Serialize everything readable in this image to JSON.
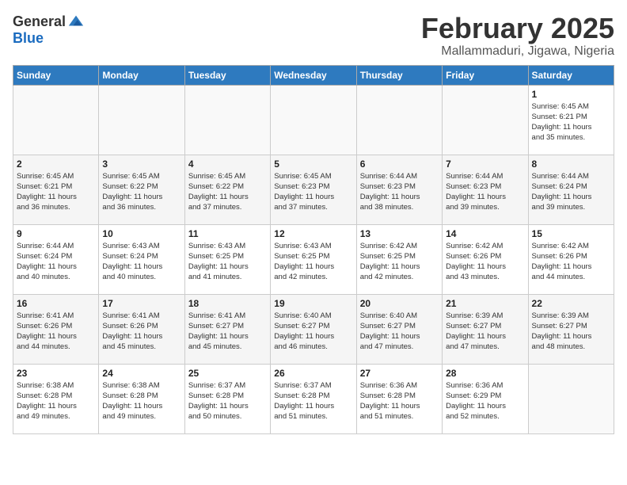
{
  "header": {
    "logo_general": "General",
    "logo_blue": "Blue",
    "month": "February 2025",
    "location": "Mallammaduri, Jigawa, Nigeria"
  },
  "days_of_week": [
    "Sunday",
    "Monday",
    "Tuesday",
    "Wednesday",
    "Thursday",
    "Friday",
    "Saturday"
  ],
  "weeks": [
    [
      {
        "day": "",
        "info": ""
      },
      {
        "day": "",
        "info": ""
      },
      {
        "day": "",
        "info": ""
      },
      {
        "day": "",
        "info": ""
      },
      {
        "day": "",
        "info": ""
      },
      {
        "day": "",
        "info": ""
      },
      {
        "day": "1",
        "info": "Sunrise: 6:45 AM\nSunset: 6:21 PM\nDaylight: 11 hours\nand 35 minutes."
      }
    ],
    [
      {
        "day": "2",
        "info": "Sunrise: 6:45 AM\nSunset: 6:21 PM\nDaylight: 11 hours\nand 36 minutes."
      },
      {
        "day": "3",
        "info": "Sunrise: 6:45 AM\nSunset: 6:22 PM\nDaylight: 11 hours\nand 36 minutes."
      },
      {
        "day": "4",
        "info": "Sunrise: 6:45 AM\nSunset: 6:22 PM\nDaylight: 11 hours\nand 37 minutes."
      },
      {
        "day": "5",
        "info": "Sunrise: 6:45 AM\nSunset: 6:23 PM\nDaylight: 11 hours\nand 37 minutes."
      },
      {
        "day": "6",
        "info": "Sunrise: 6:44 AM\nSunset: 6:23 PM\nDaylight: 11 hours\nand 38 minutes."
      },
      {
        "day": "7",
        "info": "Sunrise: 6:44 AM\nSunset: 6:23 PM\nDaylight: 11 hours\nand 39 minutes."
      },
      {
        "day": "8",
        "info": "Sunrise: 6:44 AM\nSunset: 6:24 PM\nDaylight: 11 hours\nand 39 minutes."
      }
    ],
    [
      {
        "day": "9",
        "info": "Sunrise: 6:44 AM\nSunset: 6:24 PM\nDaylight: 11 hours\nand 40 minutes."
      },
      {
        "day": "10",
        "info": "Sunrise: 6:43 AM\nSunset: 6:24 PM\nDaylight: 11 hours\nand 40 minutes."
      },
      {
        "day": "11",
        "info": "Sunrise: 6:43 AM\nSunset: 6:25 PM\nDaylight: 11 hours\nand 41 minutes."
      },
      {
        "day": "12",
        "info": "Sunrise: 6:43 AM\nSunset: 6:25 PM\nDaylight: 11 hours\nand 42 minutes."
      },
      {
        "day": "13",
        "info": "Sunrise: 6:42 AM\nSunset: 6:25 PM\nDaylight: 11 hours\nand 42 minutes."
      },
      {
        "day": "14",
        "info": "Sunrise: 6:42 AM\nSunset: 6:26 PM\nDaylight: 11 hours\nand 43 minutes."
      },
      {
        "day": "15",
        "info": "Sunrise: 6:42 AM\nSunset: 6:26 PM\nDaylight: 11 hours\nand 44 minutes."
      }
    ],
    [
      {
        "day": "16",
        "info": "Sunrise: 6:41 AM\nSunset: 6:26 PM\nDaylight: 11 hours\nand 44 minutes."
      },
      {
        "day": "17",
        "info": "Sunrise: 6:41 AM\nSunset: 6:26 PM\nDaylight: 11 hours\nand 45 minutes."
      },
      {
        "day": "18",
        "info": "Sunrise: 6:41 AM\nSunset: 6:27 PM\nDaylight: 11 hours\nand 45 minutes."
      },
      {
        "day": "19",
        "info": "Sunrise: 6:40 AM\nSunset: 6:27 PM\nDaylight: 11 hours\nand 46 minutes."
      },
      {
        "day": "20",
        "info": "Sunrise: 6:40 AM\nSunset: 6:27 PM\nDaylight: 11 hours\nand 47 minutes."
      },
      {
        "day": "21",
        "info": "Sunrise: 6:39 AM\nSunset: 6:27 PM\nDaylight: 11 hours\nand 47 minutes."
      },
      {
        "day": "22",
        "info": "Sunrise: 6:39 AM\nSunset: 6:27 PM\nDaylight: 11 hours\nand 48 minutes."
      }
    ],
    [
      {
        "day": "23",
        "info": "Sunrise: 6:38 AM\nSunset: 6:28 PM\nDaylight: 11 hours\nand 49 minutes."
      },
      {
        "day": "24",
        "info": "Sunrise: 6:38 AM\nSunset: 6:28 PM\nDaylight: 11 hours\nand 49 minutes."
      },
      {
        "day": "25",
        "info": "Sunrise: 6:37 AM\nSunset: 6:28 PM\nDaylight: 11 hours\nand 50 minutes."
      },
      {
        "day": "26",
        "info": "Sunrise: 6:37 AM\nSunset: 6:28 PM\nDaylight: 11 hours\nand 51 minutes."
      },
      {
        "day": "27",
        "info": "Sunrise: 6:36 AM\nSunset: 6:28 PM\nDaylight: 11 hours\nand 51 minutes."
      },
      {
        "day": "28",
        "info": "Sunrise: 6:36 AM\nSunset: 6:29 PM\nDaylight: 11 hours\nand 52 minutes."
      },
      {
        "day": "",
        "info": ""
      }
    ]
  ]
}
